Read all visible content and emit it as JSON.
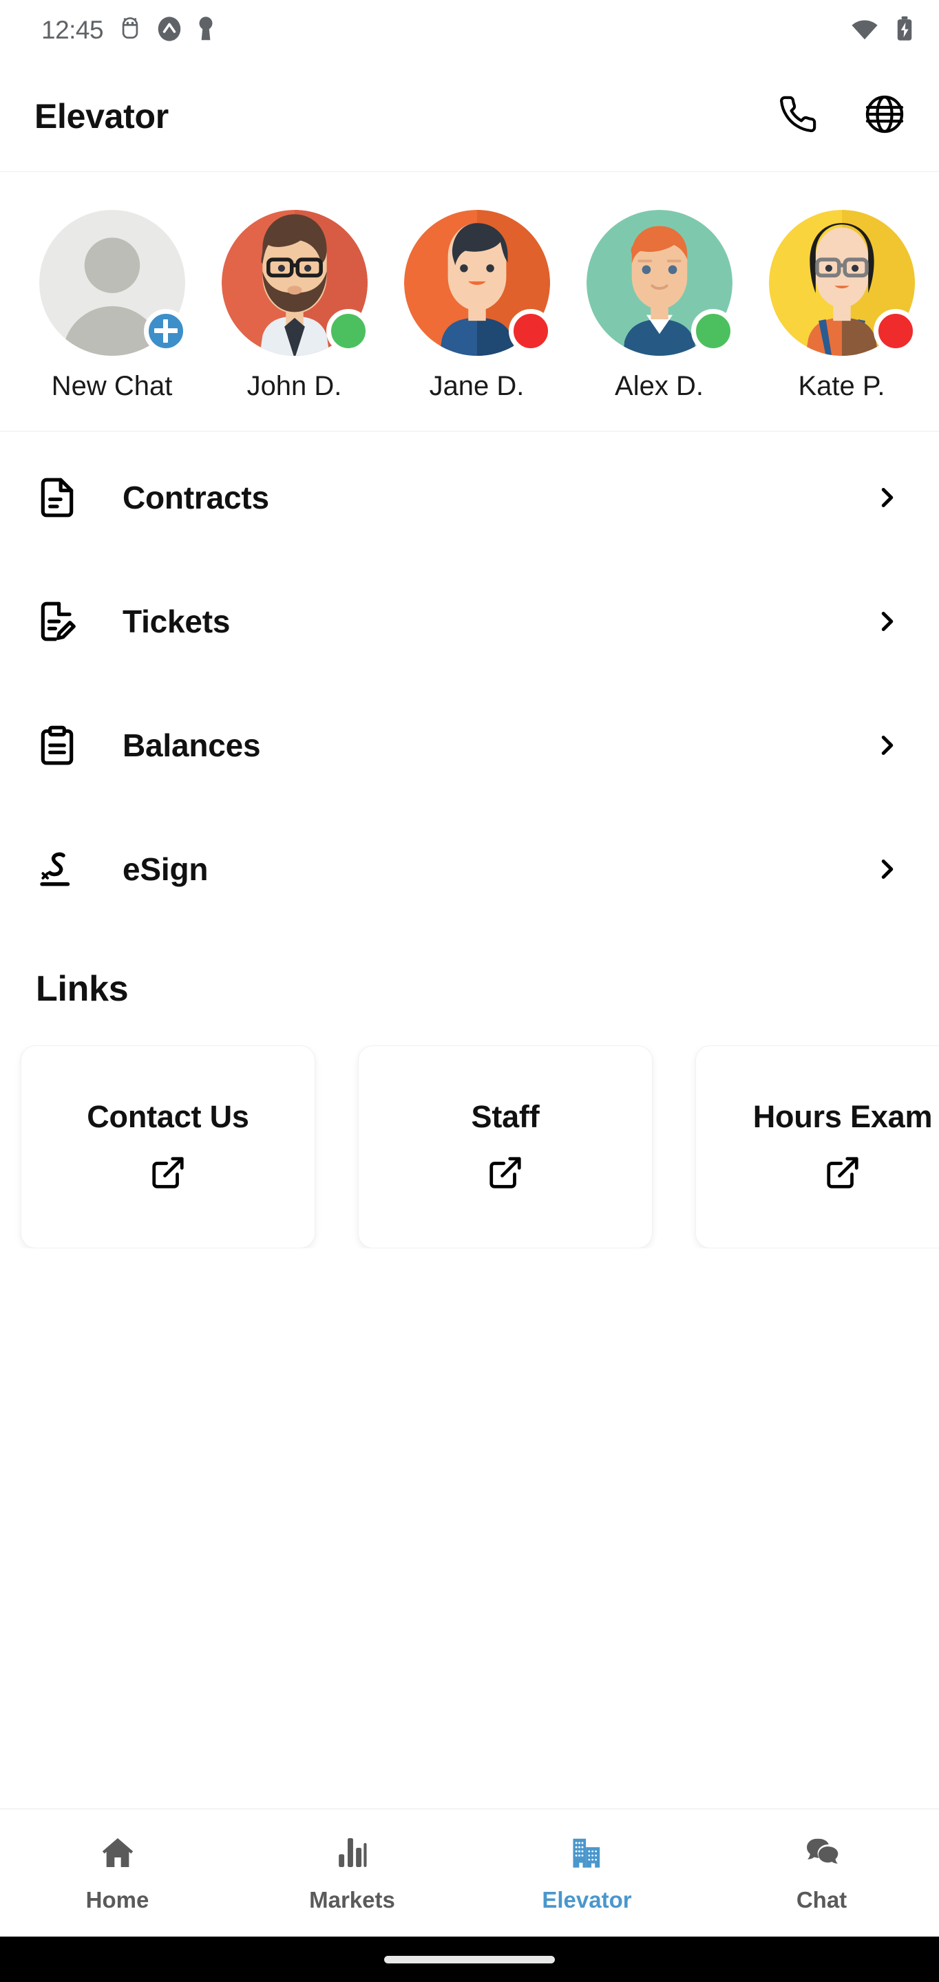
{
  "status_bar": {
    "time": "12:45",
    "left_icons": [
      "android-debug-icon",
      "app-badge-icon",
      "key-icon"
    ],
    "right_icons": [
      "wifi-icon",
      "battery-charging-icon"
    ]
  },
  "app_bar": {
    "title": "Elevator",
    "actions": [
      {
        "name": "phone-icon",
        "label": "Call"
      },
      {
        "name": "globe-icon",
        "label": "Language"
      }
    ]
  },
  "avatars": [
    {
      "label": "New Chat",
      "type": "new-chat",
      "badge": "plus",
      "bg": "#e9e9e7"
    },
    {
      "label": "John D.",
      "type": "person",
      "badge": "online",
      "bg": "#e2654a"
    },
    {
      "label": "Jane D.",
      "type": "person",
      "badge": "busy",
      "bg": "#ef6c36"
    },
    {
      "label": "Alex D.",
      "type": "person",
      "badge": "online",
      "bg": "#7ec9ae"
    },
    {
      "label": "Kate P.",
      "type": "person",
      "badge": "busy",
      "bg": "#f9d43c"
    },
    {
      "label": "",
      "type": "person",
      "badge": "none",
      "bg": "#8cc4f0"
    }
  ],
  "menu": [
    {
      "label": "Contracts",
      "icon": "document-icon",
      "chevron": "chevron-right-icon"
    },
    {
      "label": "Tickets",
      "icon": "document-edit-icon",
      "chevron": "chevron-right-icon"
    },
    {
      "label": "Balances",
      "icon": "clipboard-icon",
      "chevron": "chevron-right-icon"
    },
    {
      "label": "eSign",
      "icon": "signature-icon",
      "chevron": "chevron-right-icon"
    }
  ],
  "links": {
    "heading": "Links",
    "cards": [
      {
        "title": "Contact Us",
        "icon": "external-link-icon"
      },
      {
        "title": "Staff",
        "icon": "external-link-icon"
      },
      {
        "title": "Hours Exam",
        "icon": "external-link-icon"
      }
    ]
  },
  "bottom_nav": {
    "active": "Elevator",
    "items": [
      {
        "label": "Home",
        "icon": "home-icon",
        "active": false
      },
      {
        "label": "Markets",
        "icon": "bar-chart-icon",
        "active": false
      },
      {
        "label": "Elevator",
        "icon": "building-icon",
        "active": true
      },
      {
        "label": "Chat",
        "icon": "chat-bubble-icon",
        "active": false
      }
    ]
  },
  "colors": {
    "accent": "#4a97cd",
    "online": "#4cc05e",
    "busy": "#ef2b2b",
    "text": "#111111",
    "muted": "#5a5a5a"
  }
}
